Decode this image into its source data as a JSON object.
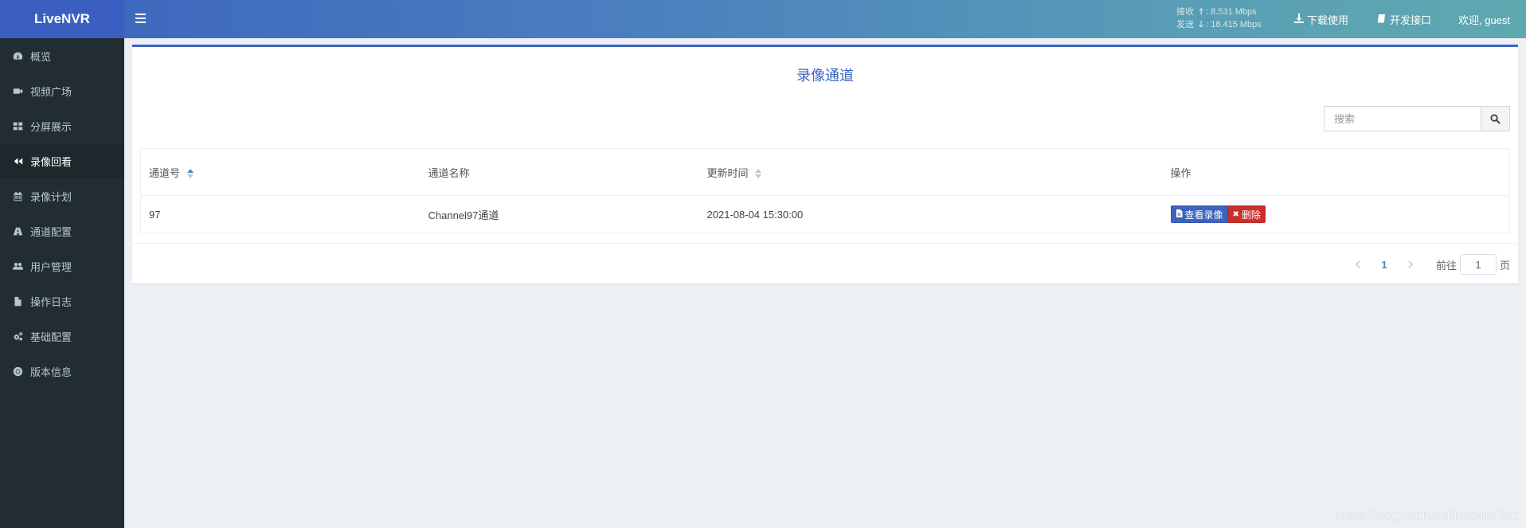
{
  "header": {
    "logo": "LiveNVR",
    "receive_label": "接收",
    "receive_value": "8.531 Mbps",
    "send_label": "发送",
    "send_value": "18.415 Mbps",
    "download": "下载使用",
    "dev_api": "开发接口",
    "welcome": "欢迎, guest"
  },
  "sidebar": {
    "items": [
      {
        "label": "概览",
        "icon": "dashboard-icon"
      },
      {
        "label": "视频广场",
        "icon": "video-camera-icon"
      },
      {
        "label": "分屏展示",
        "icon": "grid-icon"
      },
      {
        "label": "录像回看",
        "icon": "backward-icon",
        "active": true
      },
      {
        "label": "录像计划",
        "icon": "calendar-icon"
      },
      {
        "label": "通道配置",
        "icon": "road-icon"
      },
      {
        "label": "用户管理",
        "icon": "users-icon"
      },
      {
        "label": "操作日志",
        "icon": "file-icon"
      },
      {
        "label": "基础配置",
        "icon": "cogs-icon"
      },
      {
        "label": "版本信息",
        "icon": "lifebuoy-icon"
      }
    ]
  },
  "main": {
    "title": "录像通道",
    "search_placeholder": "搜索",
    "columns": [
      "通道号",
      "通道名称",
      "更新时间",
      "操作"
    ],
    "rows": [
      {
        "id": "97",
        "name": "Channel97通道",
        "updated": "2021-08-04 15:30:00"
      }
    ],
    "view_button": "查看录像",
    "delete_button": "删除",
    "pager": {
      "current": "1",
      "goto_label": "前往",
      "goto_value": "1",
      "page_suffix": "页"
    }
  },
  "watermark": "https://blog.csdn.net/Marvin1311",
  "colors": {
    "accent": "#3c63bd",
    "sidebar": "#222d32",
    "danger": "#c9302c"
  }
}
